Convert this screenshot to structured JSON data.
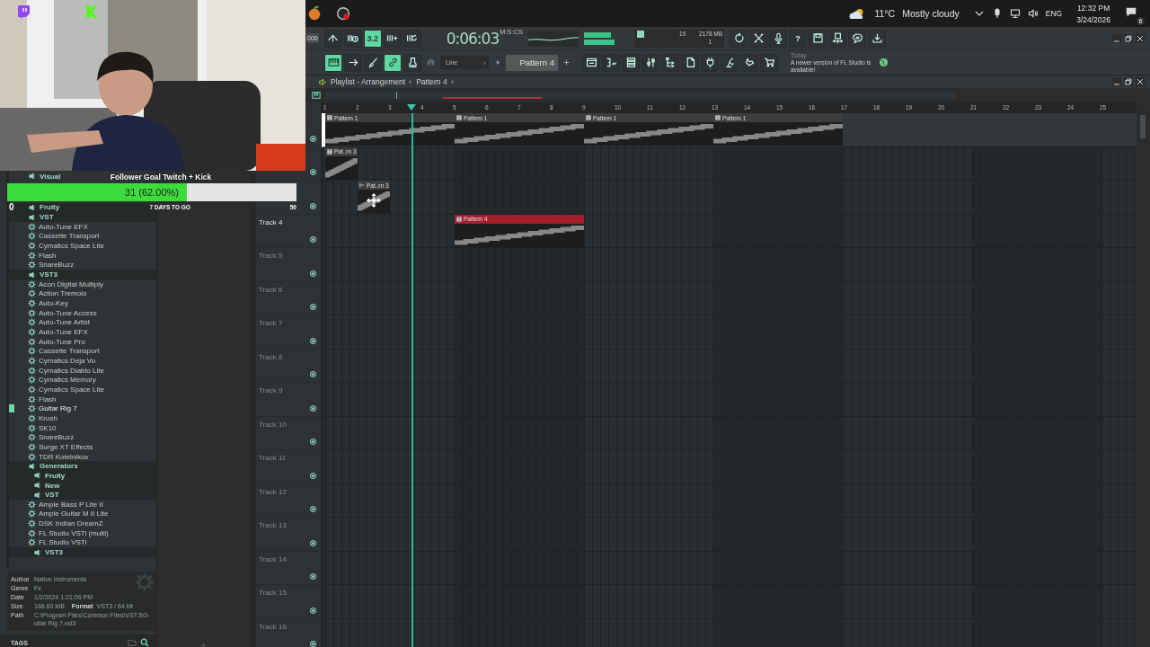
{
  "taskbar": {
    "apps": [
      {
        "kind": "fruit"
      },
      {
        "kind": "recorder"
      }
    ],
    "weather": {
      "temperature": "11°C",
      "condition": "Mostly cloudy"
    },
    "language": "ENG",
    "time": "12:32 PM",
    "date": "3/24/2026",
    "notifications": "6"
  },
  "stream_badges": [
    {
      "kind": "bubble"
    },
    {
      "kind": "square"
    }
  ],
  "follower_goal": {
    "title": "Follower Goal Twitch + Kick",
    "progress": "31 (62.00%)",
    "level": 0.62,
    "min": "0",
    "remaining": "7 DAYS TO GO",
    "max": "50"
  },
  "toolbar": {
    "tempo": "000",
    "time": "0:06:03",
    "time_format": "M:S:CS",
    "cpu": "19",
    "memory": "2178 MB",
    "polyphony": "1",
    "left_buttons": [
      {
        "kind": "caret",
        "on": false
      },
      {
        "kind": "bars-clock",
        "on": false
      },
      {
        "kind": "text",
        "label": "3.2",
        "on": true
      },
      {
        "kind": "bars-plus",
        "on": false
      },
      {
        "kind": "bars-loop",
        "on": false
      }
    ],
    "right_buttons": [
      {
        "kind": "refresh",
        "on": false
      },
      {
        "kind": "crossed-arrows",
        "on": false
      },
      {
        "kind": "microphone",
        "on": false
      },
      {
        "kind": "text",
        "label": "?",
        "on": false
      },
      {
        "kind": "floppy",
        "on": false
      },
      {
        "kind": "floppy-split",
        "on": false
      },
      {
        "kind": "speech-bubble",
        "on": false
      },
      {
        "kind": "download",
        "on": false
      }
    ],
    "mode_buttons": [
      {
        "kind": "piano",
        "on": true
      },
      {
        "kind": "arrow-right",
        "on": false
      },
      {
        "kind": "brush",
        "on": false
      },
      {
        "kind": "link",
        "on": true
      },
      {
        "kind": "stamp",
        "on": false
      }
    ],
    "snap": "Line",
    "pattern": "Pattern 4",
    "window_buttons": [
      {
        "kind": "window"
      },
      {
        "kind": "steps"
      },
      {
        "kind": "rack"
      },
      {
        "kind": "sliders"
      },
      {
        "kind": "tree"
      },
      {
        "kind": "file"
      },
      {
        "kind": "plug"
      },
      {
        "kind": "pen"
      },
      {
        "kind": "hand"
      },
      {
        "kind": "cart"
      }
    ],
    "news_date": "Today",
    "news": "A newer version of FL Studio is available!"
  },
  "browser": {
    "items": [
      {
        "label": "Visual",
        "kind": "folder"
      },
      {
        "label": "Fruity",
        "kind": "folder"
      },
      {
        "label": "VST",
        "kind": "folder",
        "children": [
          {
            "label": "Auto-Tune EFX",
            "kind": "plugin",
            "selected": false
          },
          {
            "label": "Cassette Transport",
            "kind": "plugin",
            "selected": false
          },
          {
            "label": "Cymatics Space Lite",
            "kind": "plugin",
            "selected": false
          },
          {
            "label": "Flash",
            "kind": "plugin",
            "selected": false
          },
          {
            "label": "SnareBuzz",
            "kind": "plugin",
            "selected": false
          }
        ]
      },
      {
        "label": "VST3",
        "kind": "folder",
        "children": [
          {
            "label": "Acon Digital Multiply",
            "kind": "plugin",
            "selected": false
          },
          {
            "label": "Action Tremolo",
            "kind": "plugin",
            "selected": false
          },
          {
            "label": "Auto-Key",
            "kind": "plugin",
            "selected": false
          },
          {
            "label": "Auto-Tune Access",
            "kind": "plugin",
            "selected": false
          },
          {
            "label": "Auto-Tune Artist",
            "kind": "plugin",
            "selected": false
          },
          {
            "label": "Auto-Tune EFX",
            "kind": "plugin",
            "selected": false
          },
          {
            "label": "Auto-Tune Pro",
            "kind": "plugin",
            "selected": false
          },
          {
            "label": "Cassette Transport",
            "kind": "plugin",
            "selected": false
          },
          {
            "label": "Cymatics Deja Vu",
            "kind": "plugin",
            "selected": false
          },
          {
            "label": "Cymatics Diablo Lite",
            "kind": "plugin",
            "selected": false
          },
          {
            "label": "Cymatics Memory",
            "kind": "plugin",
            "selected": false
          },
          {
            "label": "Cymatics Space Lite",
            "kind": "plugin",
            "selected": false
          },
          {
            "label": "Flash",
            "kind": "plugin",
            "selected": false
          },
          {
            "label": "Guitar Rig 7",
            "kind": "plugin",
            "selected": true
          },
          {
            "label": "Krush",
            "kind": "plugin",
            "selected": false
          },
          {
            "label": "SK10",
            "kind": "plugin",
            "selected": false
          },
          {
            "label": "SnareBuzz",
            "kind": "plugin",
            "selected": false
          },
          {
            "label": "Surge XT Effects",
            "kind": "plugin",
            "selected": false
          },
          {
            "label": "TDR Kotelnikov",
            "kind": "plugin",
            "selected": false
          }
        ]
      },
      {
        "label": "Generators",
        "kind": "folder",
        "children": [
          {
            "label": "Fruity",
            "kind": "folder"
          },
          {
            "label": "New",
            "kind": "folder"
          },
          {
            "label": "VST",
            "kind": "folder",
            "children": [
              {
                "label": "Ample Bass P Lite II",
                "kind": "plugin",
                "selected": false
              },
              {
                "label": "Ample Guitar M II Lite",
                "kind": "plugin",
                "selected": false
              },
              {
                "label": "DSK Indian DreamZ",
                "kind": "plugin",
                "selected": false
              },
              {
                "label": "FL Studio VSTi (multi)",
                "kind": "plugin",
                "selected": false
              },
              {
                "label": "FL Studio VSTi",
                "kind": "plugin",
                "selected": false
              }
            ]
          },
          {
            "label": "VST3",
            "kind": "folder"
          }
        ]
      }
    ],
    "info": [
      {
        "label": "Author",
        "value": "Native Instruments"
      },
      {
        "label": "Genre",
        "value": "Fx"
      },
      {
        "label": "Date",
        "value": "1/2/2024 1:21:06 PM"
      },
      {
        "label": "Size",
        "value": "166.60 MB",
        "extra_label": "Format",
        "extra_value": "VST3 / 64 bit"
      },
      {
        "label": "Path",
        "value_lines": [
          "C:\\Program Files\\Common Files\\VST3\\G-",
          "uitar Rig 7.vst3"
        ]
      }
    ],
    "tags": "TAGS"
  },
  "playlist": {
    "title": "Playlist - Arrangement",
    "pattern": "Pattern 4",
    "ruler": [
      "1",
      "2",
      "3",
      "4",
      "5",
      "6",
      "7",
      "8",
      "9",
      "10",
      "11",
      "12",
      "13",
      "14",
      "15",
      "16",
      "17",
      "18",
      "19",
      "20",
      "21",
      "22",
      "23",
      "24",
      "25"
    ],
    "playhead": {
      "level": 0.111
    },
    "tracks": [
      {
        "selected": true,
        "bars": [
          {
            "kind": "clip",
            "label": "Pattern 1",
            "color": "#3b3d3f",
            "dragging": false
          },
          {
            "kind": "continued"
          },
          {
            "kind": "continued"
          },
          {
            "kind": "continued"
          },
          {
            "kind": "clip",
            "label": "Pattern 1",
            "color": "#3b3d3f",
            "dragging": false
          },
          {
            "kind": "continued"
          },
          {
            "kind": "continued"
          },
          {
            "kind": "continued"
          },
          {
            "kind": "clip",
            "label": "Pattern 1",
            "color": "#3b3d3f",
            "dragging": false
          },
          {
            "kind": "continued"
          },
          {
            "kind": "continued"
          },
          {
            "kind": "continued"
          },
          {
            "kind": "clip",
            "label": "Pattern 1",
            "color": "#3b3d3f",
            "dragging": false
          },
          {
            "kind": "continued"
          },
          {
            "kind": "continued"
          },
          {
            "kind": "continued"
          }
        ]
      },
      {
        "selected": false,
        "bars": [
          {
            "kind": "clip",
            "label": "Pat..rn 3",
            "color": "#3b3d3f",
            "dragging": false
          }
        ]
      },
      {
        "selected": false,
        "bars": [
          {
            "kind": "empty"
          },
          {
            "kind": "clip",
            "label": "Pat..rn 3",
            "color": "#3b3d3f",
            "dragging": true
          }
        ]
      },
      {
        "name": "Track 4",
        "dimmed": false,
        "selected": false,
        "bars": [
          {
            "kind": "empty"
          },
          {
            "kind": "empty"
          },
          {
            "kind": "empty"
          },
          {
            "kind": "empty"
          },
          {
            "kind": "clip",
            "label": "Pattern 4",
            "color": "#a3202e",
            "dragging": false
          },
          {
            "kind": "continued"
          },
          {
            "kind": "continued"
          },
          {
            "kind": "continued"
          }
        ]
      },
      {
        "name": "Track 5",
        "dimmed": true,
        "selected": false
      },
      {
        "name": "Track 6",
        "dimmed": true,
        "selected": false
      },
      {
        "name": "Track 7",
        "dimmed": true,
        "selected": false
      },
      {
        "name": "Track 8",
        "dimmed": true,
        "selected": false
      },
      {
        "name": "Track 9",
        "dimmed": true,
        "selected": false
      },
      {
        "name": "Track 10",
        "dimmed": true,
        "selected": false
      },
      {
        "name": "Track 11",
        "dimmed": true,
        "selected": false
      },
      {
        "name": "Track 12",
        "dimmed": true,
        "selected": false
      },
      {
        "name": "Track 13",
        "dimmed": true,
        "selected": false
      },
      {
        "name": "Track 14",
        "dimmed": true,
        "selected": false
      },
      {
        "name": "Track 15",
        "dimmed": true,
        "selected": false
      },
      {
        "name": "Track 16",
        "dimmed": true,
        "selected": false
      }
    ]
  }
}
